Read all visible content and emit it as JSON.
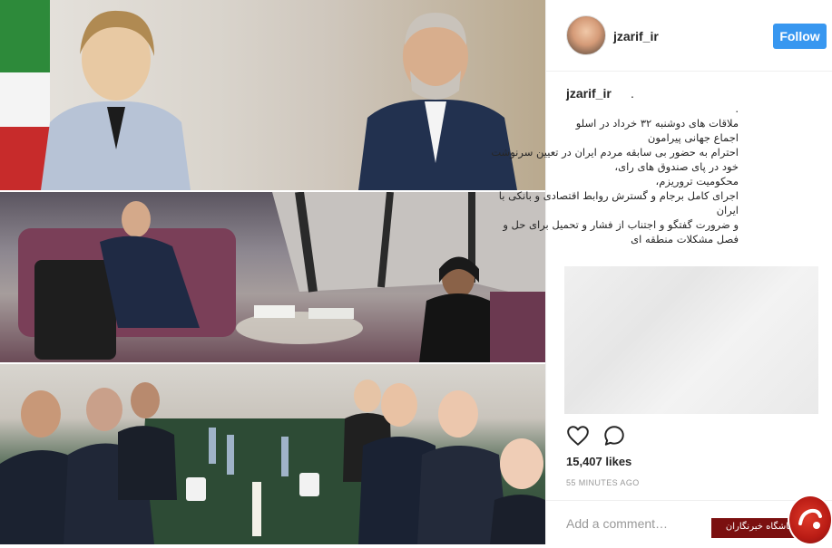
{
  "post": {
    "username": "jzarif_ir",
    "follow_label": "Follow",
    "caption_username": "jzarif_ir",
    "caption_suffix": ".",
    "caption_lines": [
      ".",
      "ملاقات های دوشنبه ۳۲ خرداد در اسلو",
      "اجماع جهانی پیرامون",
      "احترام به حضور بی سابقه مردم ایران در تعیین سرنوشت",
      "خود در پای صندوق های رای،",
      "محکومیت تروریزم،",
      "اجرای کامل برجام و گسترش روابط اقتصادی و بانکی با",
      "ایران",
      "و ضرورت گفتگو و اجتناب از فشار و تحمیل برای حل و",
      "فصل مشکلات منطقه ای"
    ],
    "likes": "15,407 likes",
    "time_ago": "55 MINUTES AGO",
    "comment_placeholder": "Add a comment…"
  },
  "icons": {
    "heart": "heart-icon",
    "comment": "comment-icon"
  },
  "watermark": {
    "text": "باشگاه خبرنگاران"
  },
  "colors": {
    "follow_button": "#3897f0",
    "watermark": "#7b1010"
  }
}
